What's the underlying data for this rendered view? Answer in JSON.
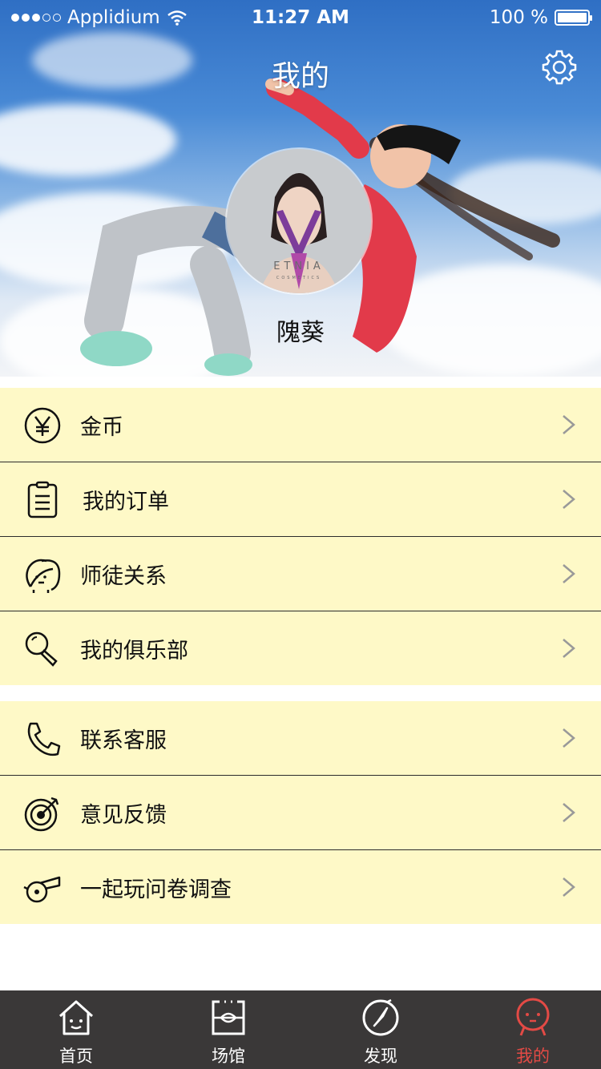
{
  "status_bar": {
    "carrier": "Applidium",
    "time": "11:27 AM",
    "battery": "100 %"
  },
  "header": {
    "title": "我的",
    "settings_icon": "gear-icon",
    "user_name": "隗葵",
    "avatar_brand": "ETNIA",
    "avatar_brand_sub": "COSMETICS"
  },
  "menu_group_1": [
    {
      "label": "金币",
      "icon": "yen-coin-icon"
    },
    {
      "label": "我的订单",
      "icon": "clipboard-icon"
    },
    {
      "label": "师徒关系",
      "icon": "two-faces-icon"
    },
    {
      "label": "我的俱乐部",
      "icon": "magnifier-icon"
    }
  ],
  "menu_group_2": [
    {
      "label": "联系客服",
      "icon": "phone-icon"
    },
    {
      "label": "意见反馈",
      "icon": "target-icon"
    },
    {
      "label": "一起玩问卷调查",
      "icon": "whistle-icon"
    }
  ],
  "tabbar": [
    {
      "label": "首页",
      "icon": "home-icon"
    },
    {
      "label": "场馆",
      "icon": "venue-icon"
    },
    {
      "label": "发现",
      "icon": "compass-icon"
    },
    {
      "label": "我的",
      "icon": "profile-icon",
      "active": true
    }
  ],
  "colors": {
    "menu_bg": "#fef9c7",
    "tabbar_bg": "#3a3838",
    "active_tab": "#e34a45"
  }
}
